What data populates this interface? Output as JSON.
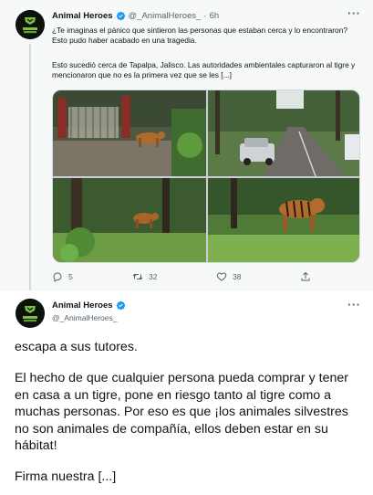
{
  "colors": {
    "verified": "#1d9bf0",
    "text_primary": "#0f1419",
    "text_secondary": "#536471",
    "thread_bg": "#f7f9f9",
    "avatar_green": "#7cc141"
  },
  "avatar": {
    "logo_text": "ANIMAL HEROES"
  },
  "thread_tweet": {
    "display_name": "Animal Heroes",
    "handle": "@_AnimalHeroes_",
    "separator": "·",
    "time": "6h",
    "more_icon": "more-horizontal-icon",
    "text_line1": "¿Te imaginas el pánico que sintieron las personas que estaban cerca y lo encontraron? Esto pudo haber acabado en una tragedia.",
    "text_line2": "Esto sucedió cerca de Tapalpa, Jalisco. Las autoridades ambientales capturaron al tigre y mencionaron que no es la primera vez que se les [...]",
    "media_photos": [
      {
        "description_icon": "tiger-gate-photo"
      },
      {
        "description_icon": "road-truck-photo"
      },
      {
        "description_icon": "tiger-forest-photo"
      },
      {
        "description_icon": "tiger-walking-photo"
      }
    ],
    "actions": {
      "reply_count": "5",
      "retweet_count": "32",
      "like_count": "38"
    }
  },
  "main_tweet": {
    "display_name": "Animal Heroes",
    "handle": "@_AnimalHeroes_",
    "more_icon": "more-horizontal-icon",
    "paragraph1": "escapa a sus tutores.",
    "paragraph2": "El hecho de que cualquier persona pueda comprar y tener en casa a un tigre, pone en riesgo tanto al tigre como a muchas personas. Por eso es que ¡los animales silvestres no son animales de compañía, ellos deben estar en su hábitat!",
    "paragraph3": "Firma nuestra [...]"
  }
}
